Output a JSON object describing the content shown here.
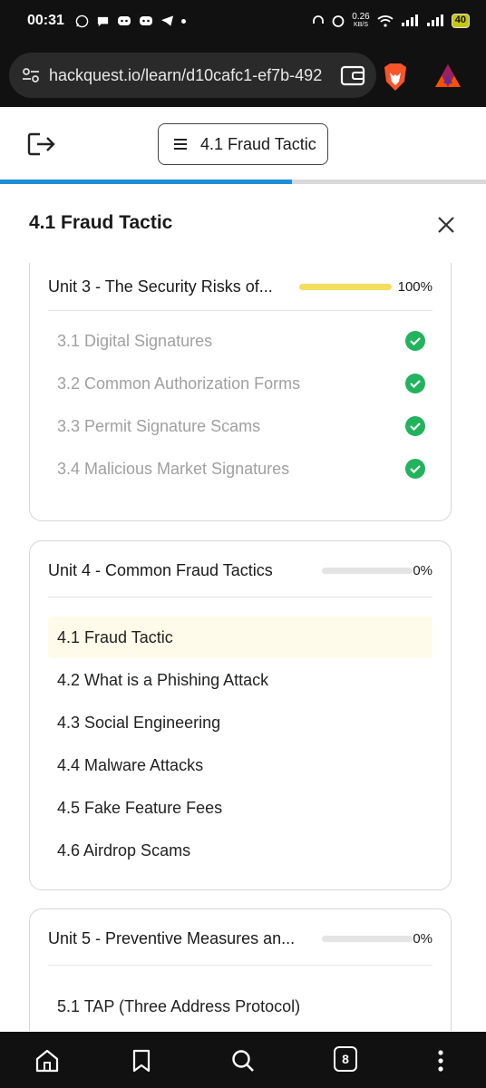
{
  "status_bar": {
    "time": "00:31",
    "network_speed": "0.26",
    "network_unit": "KB/S",
    "battery": "40"
  },
  "browser": {
    "url": "hackquest.io/learn/d10cafc1-ef7b-492",
    "tab_count": "8"
  },
  "header": {
    "current_lesson": "4.1 Fraud Tactic",
    "course_progress": 0.6
  },
  "panel": {
    "title": "4.1 Fraud Tactic"
  },
  "units": [
    {
      "title": "Unit 3 - The Security Risks of...",
      "progress_pct": 100,
      "progress_label": "100%",
      "lessons": [
        {
          "label": "3.1 Digital Signatures",
          "done": true
        },
        {
          "label": "3.2 Common Authorization Forms",
          "done": true
        },
        {
          "label": "3.3 Permit Signature Scams",
          "done": true
        },
        {
          "label": "3.4 Malicious Market Signatures",
          "done": true
        }
      ]
    },
    {
      "title": "Unit 4 - Common Fraud Tactics",
      "progress_pct": 0,
      "progress_label": "0%",
      "lessons": [
        {
          "label": "4.1 Fraud Tactic",
          "active": true
        },
        {
          "label": "4.2 What is a Phishing Attack"
        },
        {
          "label": "4.3 Social Engineering"
        },
        {
          "label": "4.4 Malware Attacks"
        },
        {
          "label": "4.5 Fake Feature Fees"
        },
        {
          "label": "4.6 Airdrop Scams"
        }
      ]
    },
    {
      "title": "Unit 5 - Preventive Measures an...",
      "progress_pct": 0,
      "progress_label": "0%",
      "lessons": [
        {
          "label": "5.1 TAP (Three Address Protocol)"
        }
      ]
    }
  ],
  "colors": {
    "accent_blue": "#1e8fd6",
    "progress_yellow": "#f5de5d",
    "check_green": "#22b35e",
    "active_bg": "#fffbea"
  }
}
